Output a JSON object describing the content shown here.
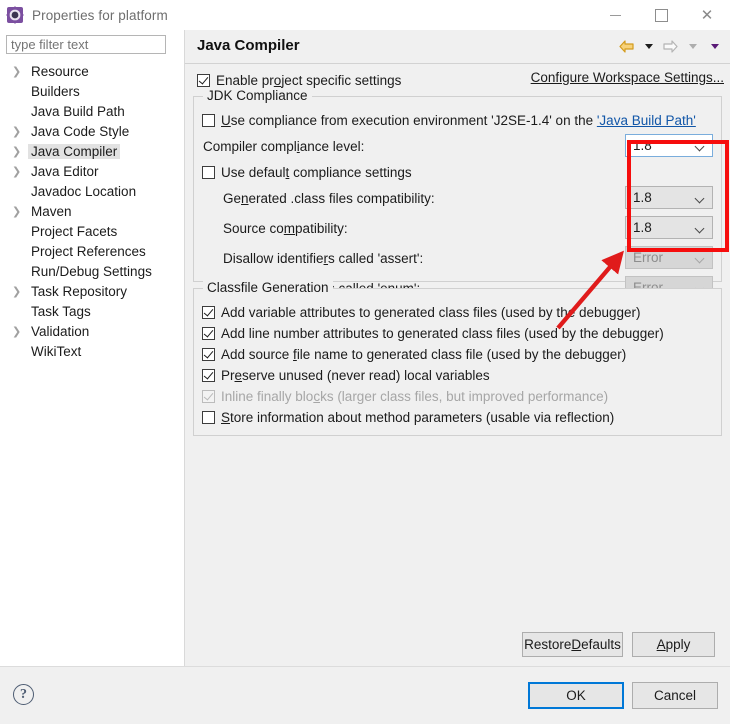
{
  "window": {
    "title": "Properties for platform",
    "icon": "properties-gear-icon",
    "controls": {
      "minimize": "minimize-icon",
      "maximize": "maximize-icon",
      "close": "close-icon"
    }
  },
  "sidebar": {
    "filter": {
      "placeholder": "type filter text",
      "value": ""
    },
    "items": [
      {
        "label": "Resource",
        "expandable": true,
        "selected": false
      },
      {
        "label": "Builders",
        "expandable": false,
        "selected": false
      },
      {
        "label": "Java Build Path",
        "expandable": false,
        "selected": false
      },
      {
        "label": "Java Code Style",
        "expandable": true,
        "selected": false
      },
      {
        "label": "Java Compiler",
        "expandable": true,
        "selected": true
      },
      {
        "label": "Java Editor",
        "expandable": true,
        "selected": false
      },
      {
        "label": "Javadoc Location",
        "expandable": false,
        "selected": false
      },
      {
        "label": "Maven",
        "expandable": true,
        "selected": false
      },
      {
        "label": "Project Facets",
        "expandable": false,
        "selected": false
      },
      {
        "label": "Project References",
        "expandable": false,
        "selected": false
      },
      {
        "label": "Run/Debug Settings",
        "expandable": false,
        "selected": false
      },
      {
        "label": "Task Repository",
        "expandable": true,
        "selected": false
      },
      {
        "label": "Task Tags",
        "expandable": false,
        "selected": false
      },
      {
        "label": "Validation",
        "expandable": true,
        "selected": false
      },
      {
        "label": "WikiText",
        "expandable": false,
        "selected": false
      }
    ]
  },
  "page": {
    "title": "Java Compiler",
    "nav": {
      "back": "back-arrow-icon",
      "back_menu": "back-dropdown-icon",
      "forward": "forward-arrow-icon",
      "forward_menu": "forward-dropdown-icon",
      "view_menu": "view-menu-icon"
    },
    "enable_project_specific": {
      "label_pre": "Enable pr",
      "label_mnemonic": "o",
      "label_post": "ject specific settings",
      "checked": true
    },
    "configure_workspace_link": "Configure Workspace Settings...",
    "jdk_compliance": {
      "legend": "JDK Compliance",
      "use_execution_env": {
        "mnemonic": "U",
        "text_a": "se compliance from execution environment 'J2SE-1.4' on the ",
        "link": "'Java Build Path'",
        "checked": false
      },
      "compiler_compliance_level": {
        "label_pre": "Compiler compl",
        "label_mnemonic": "i",
        "label_post": "ance level:",
        "value": "1.8",
        "state": "focused"
      },
      "use_default_compliance": {
        "label_pre": "Use defaul",
        "label_mnemonic": "t",
        "label_post": " compliance settings",
        "checked": false
      },
      "generated_class_files": {
        "label_pre": "Ge",
        "label_mnemonic": "n",
        "label_post": "erated .class files compatibility:",
        "value": "1.8",
        "state": "enabled"
      },
      "source_compatibility": {
        "label_pre": "Source co",
        "label_mnemonic": "m",
        "label_post": "patibility:",
        "value": "1.8",
        "state": "enabled"
      },
      "disallow_assert": {
        "label_pre": "Disallow identifie",
        "label_mnemonic": "r",
        "label_post": "s called 'assert':",
        "value": "Error",
        "state": "disabled"
      },
      "disallow_enum": {
        "label_pre": "Disallo",
        "label_mnemonic": "w",
        "label_post": " identifiers called 'enum':",
        "value": "Error",
        "state": "disabled"
      }
    },
    "classfile_generation": {
      "legend": "Classfile Generation",
      "options": [
        {
          "pre": "Add variable attributes to generated class files (used by the debugger)",
          "mnemonic": "",
          "post": "",
          "checked": true,
          "disabled": false
        },
        {
          "pre": "Add line number attributes to generated class files (used by the debugger)",
          "mnemonic": "",
          "post": "",
          "checked": true,
          "disabled": false
        },
        {
          "pre": "Add source ",
          "mnemonic": "f",
          "post": "ile name to generated class file (used by the debugger)",
          "checked": true,
          "disabled": false
        },
        {
          "pre": "Pr",
          "mnemonic": "e",
          "post": "serve unused (never read) local variables",
          "checked": true,
          "disabled": false
        },
        {
          "pre": "Inline finally blo",
          "mnemonic": "c",
          "post": "ks (larger class files, but improved performance)",
          "checked": true,
          "disabled": true
        },
        {
          "pre": "",
          "mnemonic": "S",
          "post": "tore information about method parameters (usable via reflection)",
          "checked": false,
          "disabled": false
        }
      ]
    },
    "buttons": {
      "restore_defaults_pre": "Restore ",
      "restore_defaults_mnemonic": "D",
      "restore_defaults_post": "efaults",
      "apply_mnemonic": "A",
      "apply_post": "pply"
    }
  },
  "footer": {
    "help": "?",
    "ok": "OK",
    "cancel": "Cancel"
  },
  "annotations": {
    "highlight_box_color": "#f60d0d",
    "arrow_color": "#e01b1b",
    "box_target": "compliance-level-dropdowns",
    "arrow_points_to": "compliance-level-dropdowns"
  }
}
